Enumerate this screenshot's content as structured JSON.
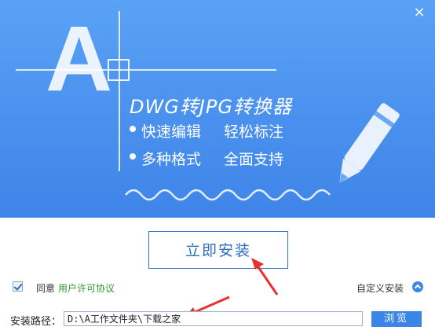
{
  "banner": {
    "logo_letter": "A",
    "title": "DWG转JPG转换器",
    "features": [
      "快速编辑",
      "轻松标注",
      "多种格式",
      "全面支持"
    ],
    "background_color": "#4a90ee"
  },
  "window": {
    "close_icon": "close-icon",
    "close_glyph": "×"
  },
  "install": {
    "button_label": "立即安装"
  },
  "agreement": {
    "checked": true,
    "label": "同意",
    "link_text": "用户许可协议"
  },
  "custom": {
    "label": "自定义安装",
    "toggle_icon": "chevron-up-icon"
  },
  "path": {
    "label": "安装路径：",
    "value": "D:\\A工作文件夹\\下载之家",
    "browse_label": "浏览"
  },
  "colors": {
    "accent": "#3a85e6",
    "link": "#2f9a31",
    "arrow": "#e8302e"
  }
}
